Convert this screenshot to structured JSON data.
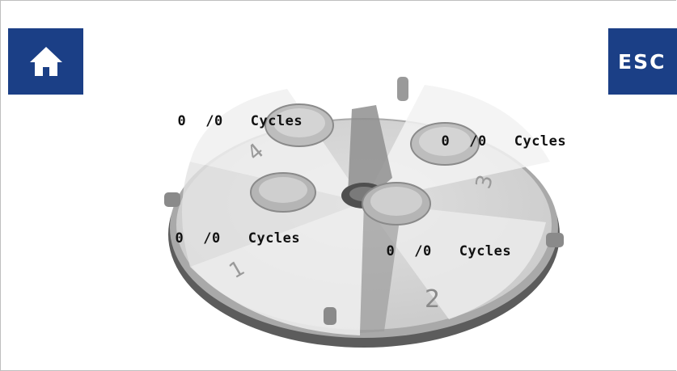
{
  "toolbar": {
    "home_icon": "home-icon",
    "esc_label": "ESC",
    "button_color": "#1b3f86"
  },
  "rotor": {
    "positions": [
      {
        "number": "1",
        "current": "0",
        "total": "/0",
        "unit": "Cycles"
      },
      {
        "number": "2",
        "current": "0",
        "total": "/0",
        "unit": "Cycles"
      },
      {
        "number": "3",
        "current": "0",
        "total": "/0",
        "unit": "Cycles"
      },
      {
        "number": "4",
        "current": "0",
        "total": "/0",
        "unit": "Cycles"
      }
    ]
  }
}
